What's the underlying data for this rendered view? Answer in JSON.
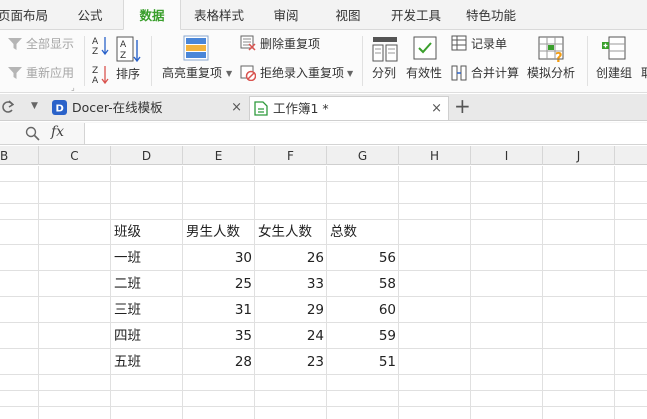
{
  "menu_tabs": [
    {
      "label": "页面布局"
    },
    {
      "label": "公式"
    },
    {
      "label": "数据",
      "active": true
    },
    {
      "label": "表格样式"
    },
    {
      "label": "审阅"
    },
    {
      "label": "视图"
    },
    {
      "label": "开发工具"
    },
    {
      "label": "特色功能"
    }
  ],
  "ribbon": {
    "show_all": "全部显示",
    "reapply": "重新应用",
    "sort": "排序",
    "highlight_duplicates": "高亮重复项",
    "remove_duplicates": "删除重复项",
    "reject_duplicates": "拒绝录入重复项",
    "split": "分列",
    "validity": "有效性",
    "record_form": "记录单",
    "consolidate": "合并计算",
    "simulation": "模拟分析",
    "create_group": "创建组",
    "cut_label": "取"
  },
  "doc_tabs": [
    {
      "label": "Docer-在线模板",
      "close": "×"
    },
    {
      "label": "工作簿1 *",
      "close": "×"
    }
  ],
  "new_tab": "+",
  "formula_bar": {
    "fx": "fx",
    "value": ""
  },
  "columns": [
    "B",
    "C",
    "D",
    "E",
    "F",
    "G",
    "H",
    "I",
    "J"
  ],
  "table": {
    "headers": [
      "班级",
      "男生人数",
      "女生人数",
      "总数"
    ],
    "rows": [
      [
        "一班",
        "30",
        "26",
        "56"
      ],
      [
        "二班",
        "25",
        "33",
        "58"
      ],
      [
        "三班",
        "31",
        "29",
        "60"
      ],
      [
        "四班",
        "35",
        "24",
        "59"
      ],
      [
        "五班",
        "28",
        "23",
        "51"
      ]
    ]
  },
  "colors": {
    "accent": "#3a9f2c",
    "docer_blue": "#2a62c9",
    "sheet_green": "#2e9a3c"
  }
}
